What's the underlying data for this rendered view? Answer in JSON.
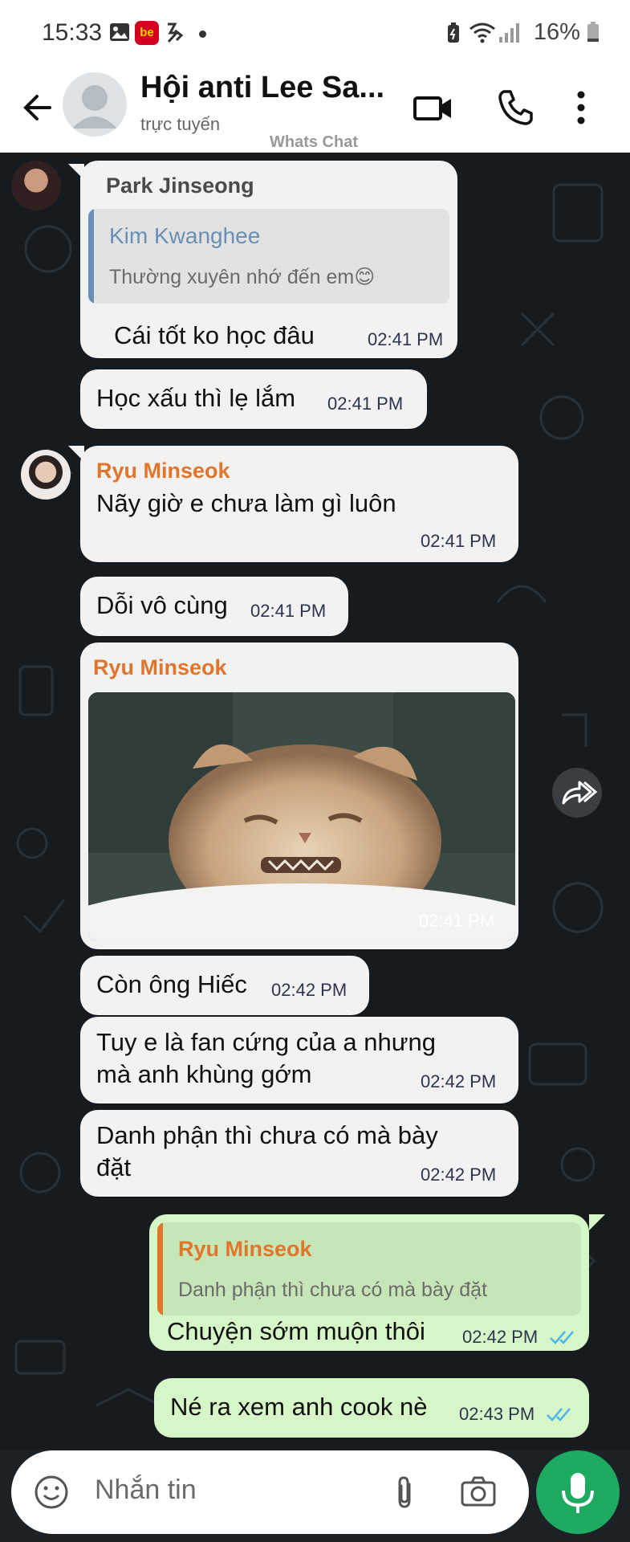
{
  "status_bar": {
    "time": "15:33",
    "app_badge": "be",
    "battery": "16%"
  },
  "header": {
    "title": "Hội anti Lee Sa...",
    "subtitle": "trực tuyến",
    "watermark": "Whats Chat"
  },
  "messages": [
    {
      "sender": "Park Jinseong",
      "quote": {
        "name": "Kim Kwanghee",
        "text": "Thường xuyên nhớ đến em😊"
      },
      "text": "Cái tốt ko học đâu",
      "time": "02:41 PM"
    },
    {
      "text": "Học xấu thì lẹ lắm",
      "time": "02:41 PM"
    },
    {
      "sender": "Ryu Minseok",
      "text": "Nãy giờ e chưa làm gì luôn",
      "time": "02:41 PM"
    },
    {
      "text": "Dỗi vô cùng",
      "time": "02:41 PM"
    },
    {
      "sender": "Ryu Minseok",
      "image": "cat-photo",
      "time": "02:41 PM"
    },
    {
      "text": "Còn ông Hiếc",
      "time": "02:42 PM"
    },
    {
      "lines": [
        "Tuy e là fan cứng của a nhưng",
        "mà anh khùng gớm"
      ],
      "time": "02:42 PM"
    },
    {
      "lines": [
        "Danh phận thì chưa có mà bày",
        "đặt"
      ],
      "time": "02:42 PM"
    },
    {
      "outgoing": true,
      "quote": {
        "name": "Ryu Minseok",
        "text": "Danh phận thì chưa có mà bày đặt"
      },
      "text": "Chuyện sớm muộn thôi",
      "time": "02:42 PM"
    },
    {
      "outgoing": true,
      "text": "Né ra xem anh cook nè",
      "time": "02:43 PM"
    }
  ],
  "input": {
    "placeholder": "Nhắn tin"
  },
  "icons": {
    "back": "back-arrow-icon",
    "video": "video-call-icon",
    "phone": "phone-call-icon",
    "more": "more-vertical-icon",
    "forward": "forward-icon",
    "emoji": "emoji-icon",
    "attach": "paperclip-icon",
    "camera": "camera-icon",
    "mic": "microphone-icon",
    "read": "double-check-icon"
  },
  "colors": {
    "orange_sender": "#e0752b",
    "blue_quote": "#6a8fb6",
    "outgoing_bubble": "#d7f6c7",
    "incoming_bubble": "#f2f2f2",
    "mic_button": "#1eaa61",
    "read_ticks": "#4fb6ec"
  }
}
